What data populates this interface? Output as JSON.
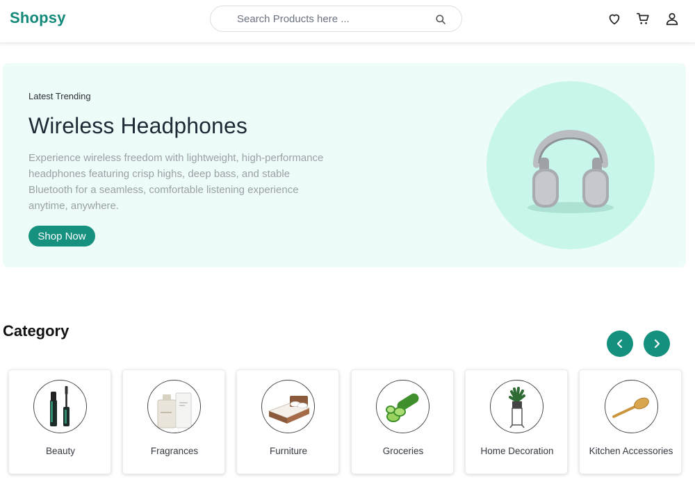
{
  "header": {
    "logo": "Shopsy",
    "search_placeholder": "Search Products here ...",
    "icons": [
      "search-icon",
      "heart-icon",
      "cart-icon",
      "user-icon"
    ]
  },
  "hero": {
    "subtitle": "Latest Trending",
    "title": "Wireless Headphones",
    "description": "Experience wireless freedom with lightweight, high-performance headphones featuring crisp highs, deep bass, and stable Bluetooth for a seamless, comfortable listening experience anytime, anywhere.",
    "button_label": "Shop Now",
    "image": "headphones-image"
  },
  "category": {
    "title": "Category",
    "prev_icon": "chevron-left-icon",
    "next_icon": "chevron-right-icon",
    "items": [
      {
        "label": "Beauty",
        "image": "mascara-image"
      },
      {
        "label": "Fragrances",
        "image": "perfume-image"
      },
      {
        "label": "Furniture",
        "image": "bed-image"
      },
      {
        "label": "Groceries",
        "image": "cucumber-image"
      },
      {
        "label": "Home Decoration",
        "image": "plant-image"
      },
      {
        "label": "Kitchen Accessories",
        "image": "spatula-image"
      }
    ]
  },
  "colors": {
    "brand": "#13897a",
    "hero_bg": "#edfcf9",
    "hero_circle": "#c8f6ea"
  }
}
